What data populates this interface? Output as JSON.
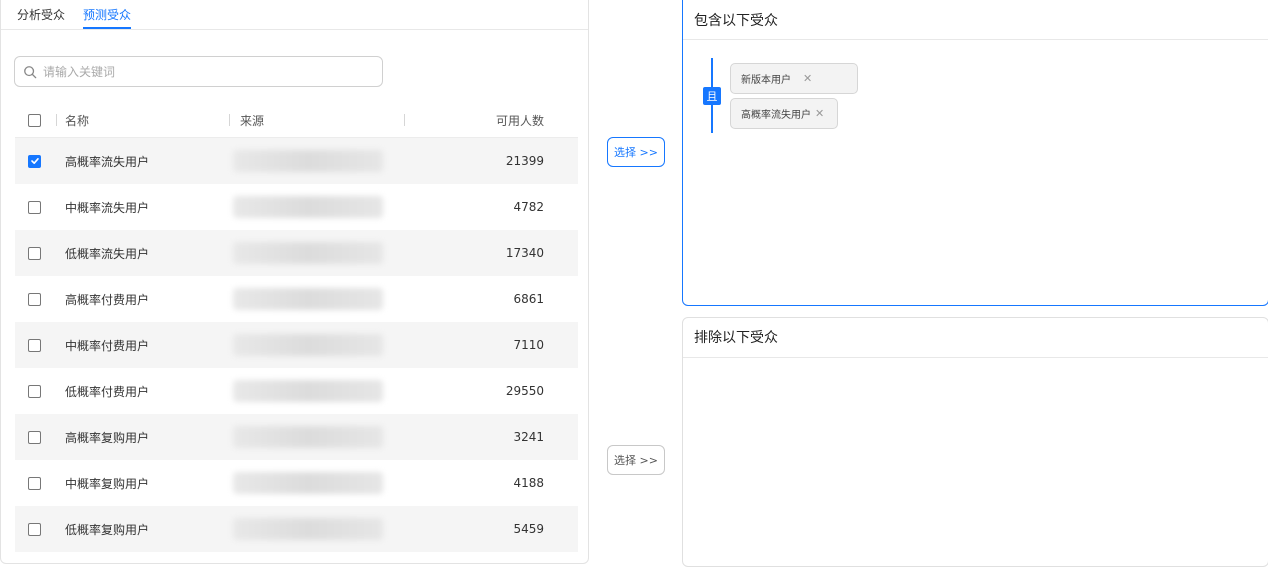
{
  "tabs": [
    {
      "label": "分析受众",
      "active": false
    },
    {
      "label": "预测受众",
      "active": true
    }
  ],
  "search": {
    "placeholder": "请输入关键词"
  },
  "table": {
    "headers": {
      "name": "名称",
      "source": "来源",
      "count": "可用人数"
    },
    "rows": [
      {
        "name": "高概率流失用户",
        "count": "21399",
        "checked": true
      },
      {
        "name": "中概率流失用户",
        "count": "4782",
        "checked": false
      },
      {
        "name": "低概率流失用户",
        "count": "17340",
        "checked": false
      },
      {
        "name": "高概率付费用户",
        "count": "6861",
        "checked": false
      },
      {
        "name": "中概率付费用户",
        "count": "7110",
        "checked": false
      },
      {
        "name": "低概率付费用户",
        "count": "29550",
        "checked": false
      },
      {
        "name": "高概率复购用户",
        "count": "3241",
        "checked": false
      },
      {
        "name": "中概率复购用户",
        "count": "4188",
        "checked": false
      },
      {
        "name": "低概率复购用户",
        "count": "5459",
        "checked": false
      }
    ]
  },
  "buttons": {
    "select_include": "选择 >>",
    "select_exclude": "选择 >>"
  },
  "include": {
    "title": "包含以下受众",
    "logic": "且",
    "tags": [
      "新版本用户",
      "高概率流失用户"
    ]
  },
  "exclude": {
    "title": "排除以下受众"
  },
  "colors": {
    "accent": "#1677ff"
  }
}
